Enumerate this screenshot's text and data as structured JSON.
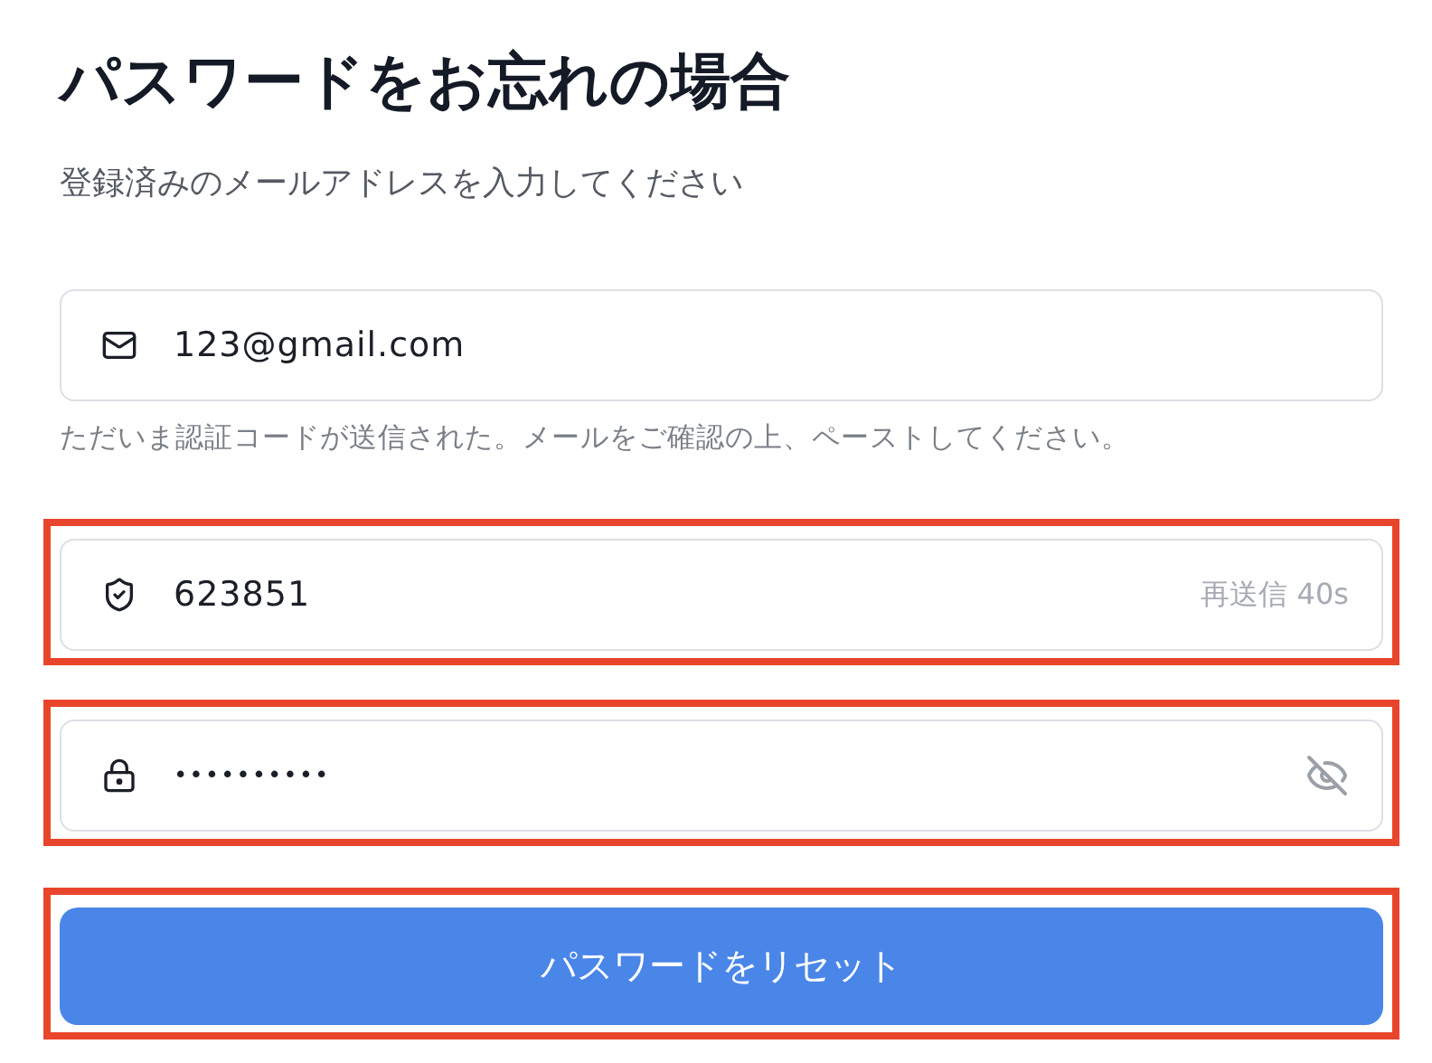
{
  "title": "パスワードをお忘れの場合",
  "subtitle": "登録済みのメールアドレスを入力してください",
  "fields": [
    {
      "kind": "email",
      "value": "123@gmail.com",
      "highlighted": false,
      "hint": "ただいま認証コードが送信された。メールをご確認の上、ペーストしてください。"
    },
    {
      "kind": "code",
      "value": "623851",
      "highlighted": true,
      "action": "再送信 40s"
    },
    {
      "kind": "password",
      "value": "••••••••••",
      "highlighted": true,
      "revealed": false
    }
  ],
  "submit": {
    "label": "パスワードをリセット",
    "highlighted": true
  }
}
